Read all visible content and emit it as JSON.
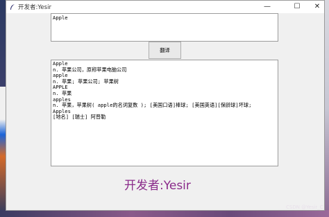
{
  "window": {
    "title": "开发者:Yesir",
    "icon": "feather-icon",
    "controls": {
      "minimize": "—",
      "maximize": "☐",
      "close": "✕"
    }
  },
  "input": {
    "value": "Apple"
  },
  "translate_button": {
    "label": "翻译"
  },
  "output": {
    "lines": [
      "Apple",
      "n. 苹果公司，原称苹果电脑公司",
      "apple",
      "n. 苹果; 苹果公司; 苹果树",
      "APPLE",
      "n. 苹果",
      "apples",
      "n. 苹果，苹果树( apple的名词复数 ); [美国口语]棒球; [美国英语][保龄球]坏球;",
      "Apples",
      "[地名] [瑞士] 阿普勒"
    ]
  },
  "author_label": "开发者:Yesir",
  "watermark": "CSDN @Yesir_C"
}
